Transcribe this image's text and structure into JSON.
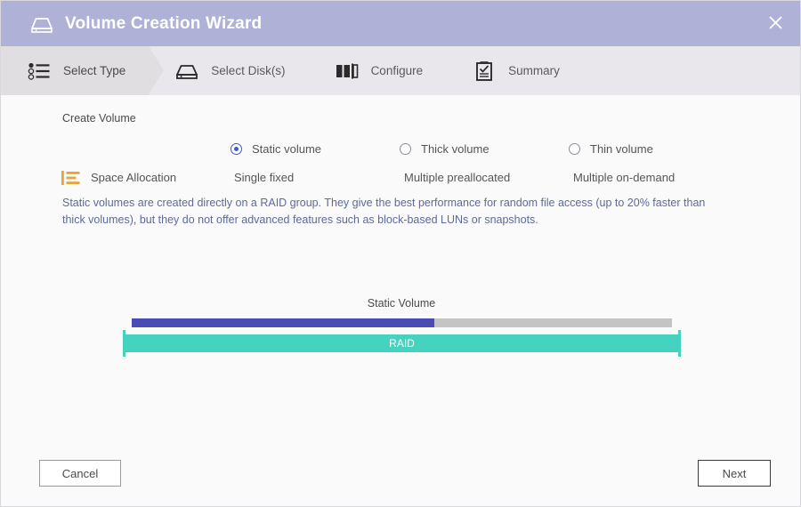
{
  "window": {
    "title": "Volume Creation Wizard",
    "title_icon": "nas-drive-icon",
    "close_label": "✕"
  },
  "steps": [
    {
      "label": "Select Type",
      "icon": "list-select-icon",
      "active": true
    },
    {
      "label": "Select Disk(s)",
      "icon": "nas-drive-icon",
      "active": false
    },
    {
      "label": "Configure",
      "icon": "blocks-icon",
      "active": false
    },
    {
      "label": "Summary",
      "icon": "clipboard-check-icon",
      "active": false
    }
  ],
  "main": {
    "section_title": "Create Volume",
    "options": [
      {
        "label": "Static volume",
        "allocation": "Single fixed",
        "checked": true
      },
      {
        "label": "Thick volume",
        "allocation": "Multiple preallocated",
        "checked": false
      },
      {
        "label": "Thin volume",
        "allocation": "Multiple on-demand",
        "checked": false
      }
    ],
    "allocation_row_title": "Space Allocation",
    "allocation_icon": "space-allocation-icon",
    "description": "Static volumes are created directly on a RAID group. They give the best performance for random file access (up to 20% faster than thick volumes), but they do not offer advanced features such as block-based LUNs or snapshots."
  },
  "diagram": {
    "caption": "Static Volume",
    "raid_label": "RAID",
    "volume_fill_percent": 56,
    "colors": {
      "volume_fill": "#4a4bb5",
      "volume_track": "#c4c4c4",
      "raid": "#45d3c0"
    }
  },
  "footer": {
    "cancel_label": "Cancel",
    "next_label": "Next"
  },
  "theme": {
    "titlebar_bg": "#aeb2d6",
    "steps_bg": "#eae7ec",
    "step_active_bg": "#e0dee1",
    "body_bg": "#fafafa",
    "description_text": "#5d6a9a",
    "accent_orange": "#e8a33d",
    "radio_selected": "#3b5bd0"
  }
}
